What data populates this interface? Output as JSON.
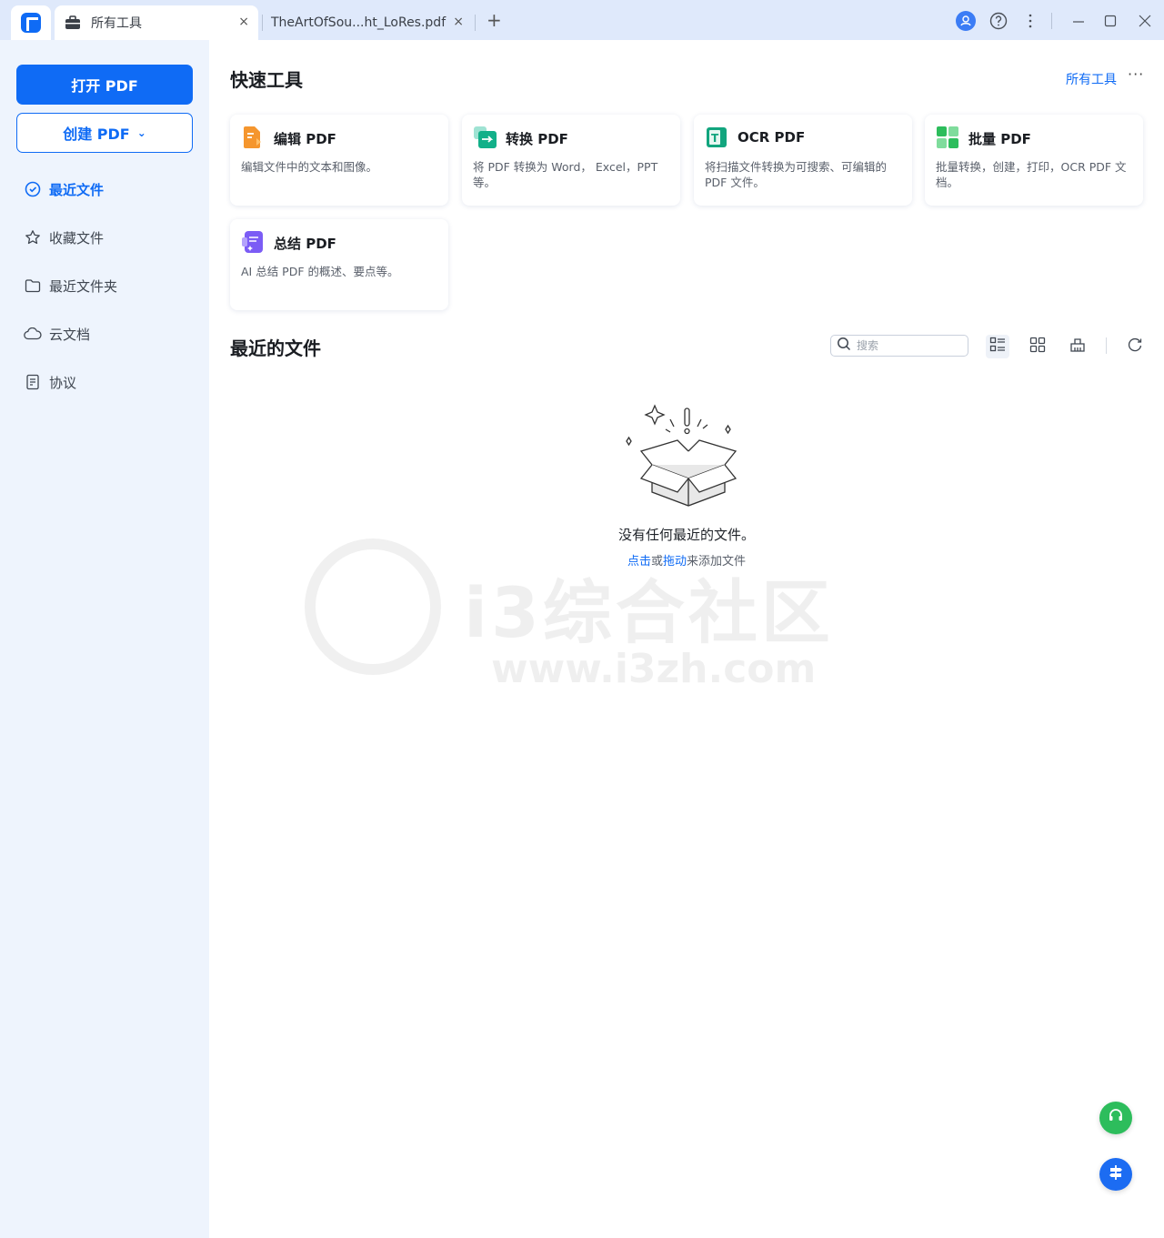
{
  "titlebar": {
    "tabs": [
      {
        "label": "所有工具",
        "icon": "toolbox-icon"
      },
      {
        "label": "TheArtOfSou...ht_LoRes.pdf",
        "icon": "none"
      }
    ],
    "close_glyph": "×",
    "new_tab_glyph": "+"
  },
  "sidebar": {
    "open_pdf": "打开 PDF",
    "create_pdf": "创建 PDF",
    "create_chevron": "⌄",
    "nav": [
      {
        "label": "最近文件",
        "icon": "clock-icon",
        "active": true
      },
      {
        "label": "收藏文件",
        "icon": "star-icon",
        "active": false
      },
      {
        "label": "最近文件夹",
        "icon": "folder-icon",
        "active": false
      },
      {
        "label": "云文档",
        "icon": "cloud-icon",
        "active": false
      },
      {
        "label": "协议",
        "icon": "document-icon",
        "active": false
      }
    ]
  },
  "quick_tools": {
    "title": "快速工具",
    "all_tools_link": "所有工具",
    "more": "···",
    "cards": [
      {
        "title": "编辑 PDF",
        "desc": "编辑文件中的文本和图像。",
        "icon": "edit-pdf-icon",
        "color": "#f5962e"
      },
      {
        "title": "转换 PDF",
        "desc": "将 PDF 转换为 Word， Excel，PPT 等。",
        "icon": "convert-pdf-icon",
        "color": "#19b89a"
      },
      {
        "title": "OCR PDF",
        "desc": "将扫描文件转换为可搜索、可编辑的 PDF 文件。",
        "icon": "ocr-pdf-icon",
        "color": "#12a57e"
      },
      {
        "title": "批量 PDF",
        "desc": "批量转换，创建，打印，OCR PDF 文档。",
        "icon": "batch-pdf-icon",
        "color": "#2dbd5c"
      },
      {
        "title": "总结 PDF",
        "desc": "AI 总结 PDF 的概述、要点等。",
        "icon": "summarize-pdf-icon",
        "color": "#7b5cf5"
      }
    ]
  },
  "recent": {
    "title": "最近的文件",
    "search_placeholder": "搜索",
    "empty_text": "没有任何最近的文件。",
    "empty_click": "点击",
    "empty_or": "或",
    "empty_drag": "拖动",
    "empty_tail": "来添加文件"
  },
  "watermark": {
    "text": "i3综合社区",
    "url": "www.i3zh.com"
  },
  "colors": {
    "accent": "#0f6bf5",
    "sidebar_bg": "#eef4fd",
    "titlebar_bg": "#dfe9fb"
  }
}
